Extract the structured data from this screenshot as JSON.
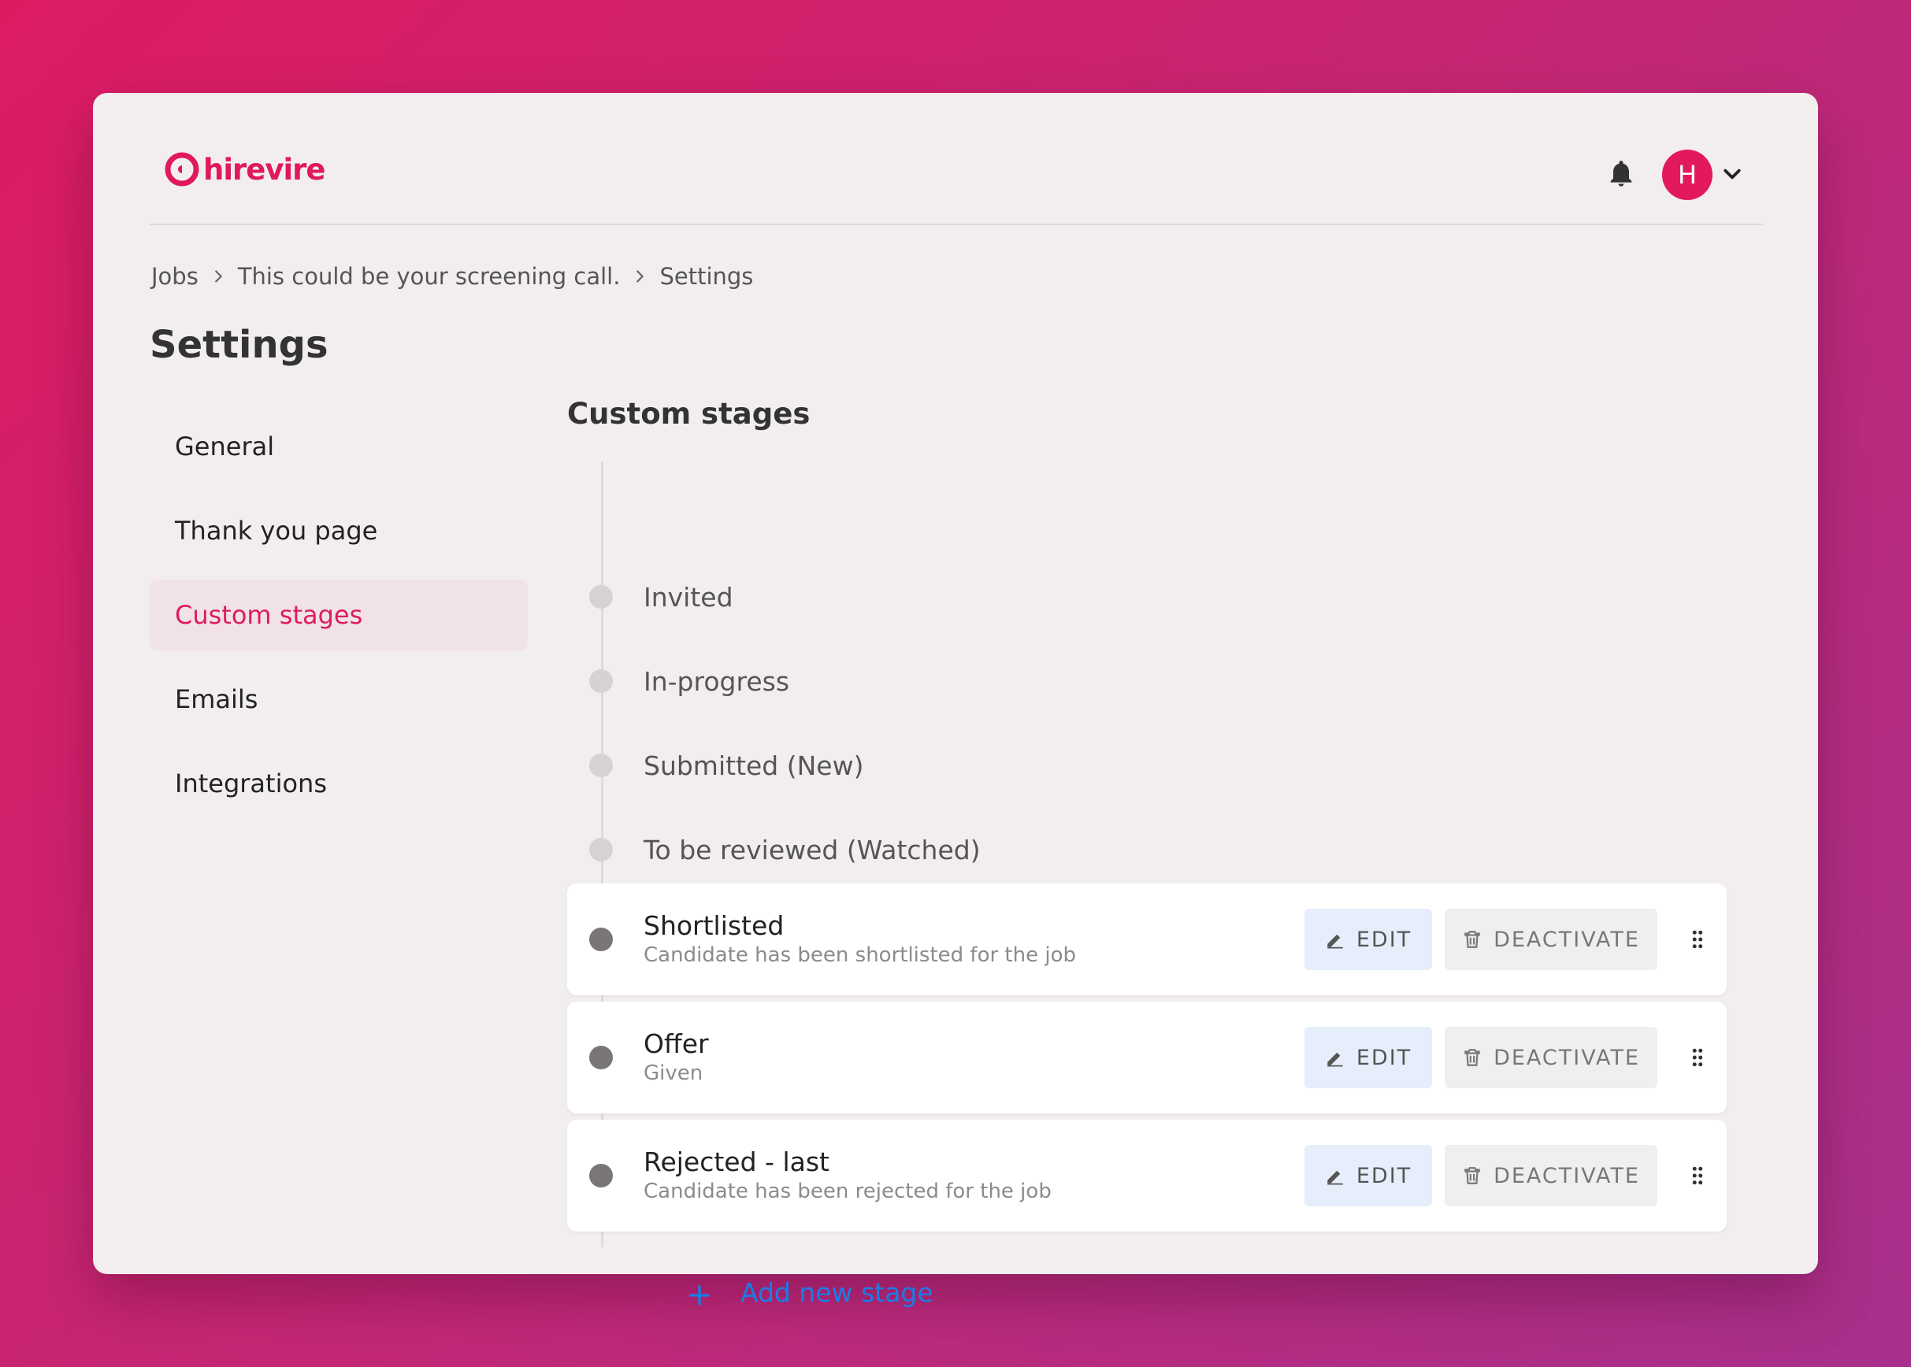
{
  "brand": {
    "name": "hirevire",
    "color": "#e0195e"
  },
  "header": {
    "notification_icon": "bell-icon",
    "avatar_initial": "H",
    "menu_icon": "chevron-down-icon"
  },
  "breadcrumb": [
    "Jobs",
    "This could be your screening call.",
    "Settings"
  ],
  "page_title": "Settings",
  "sidebar": {
    "items": [
      {
        "label": "General",
        "active": false
      },
      {
        "label": "Thank you page",
        "active": false
      },
      {
        "label": "Custom stages",
        "active": true
      },
      {
        "label": "Emails",
        "active": false
      },
      {
        "label": "Integrations",
        "active": false
      }
    ]
  },
  "section_title": "Custom stages",
  "default_stages": [
    "Invited",
    "In-progress",
    "Submitted (New)",
    "To be reviewed (Watched)"
  ],
  "custom_stages": [
    {
      "name": "Shortlisted",
      "description": "Candidate has been shortlisted for the job"
    },
    {
      "name": "Offer",
      "description": "Given"
    },
    {
      "name": "Rejected - last",
      "description": "Candidate has been rejected for the job"
    }
  ],
  "buttons": {
    "edit_label": "EDIT",
    "deactivate_label": "DEACTIVATE"
  },
  "add_stage_label": "Add new stage",
  "colors": {
    "accent": "#e0195e",
    "link": "#1a7de6",
    "active_bg": "#f1e2e7"
  }
}
